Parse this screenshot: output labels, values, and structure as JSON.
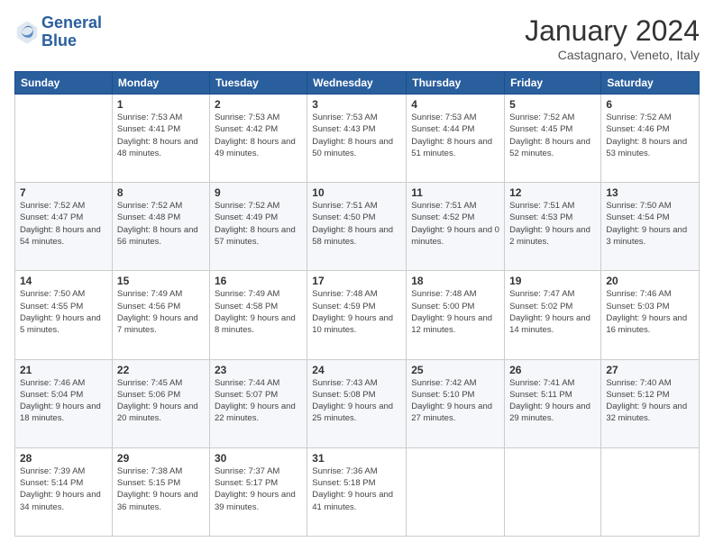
{
  "header": {
    "logo_line1": "General",
    "logo_line2": "Blue",
    "month_title": "January 2024",
    "subtitle": "Castagnaro, Veneto, Italy"
  },
  "days_of_week": [
    "Sunday",
    "Monday",
    "Tuesday",
    "Wednesday",
    "Thursday",
    "Friday",
    "Saturday"
  ],
  "weeks": [
    [
      {
        "day": "",
        "sunrise": "",
        "sunset": "",
        "daylight": ""
      },
      {
        "day": "1",
        "sunrise": "Sunrise: 7:53 AM",
        "sunset": "Sunset: 4:41 PM",
        "daylight": "Daylight: 8 hours and 48 minutes."
      },
      {
        "day": "2",
        "sunrise": "Sunrise: 7:53 AM",
        "sunset": "Sunset: 4:42 PM",
        "daylight": "Daylight: 8 hours and 49 minutes."
      },
      {
        "day": "3",
        "sunrise": "Sunrise: 7:53 AM",
        "sunset": "Sunset: 4:43 PM",
        "daylight": "Daylight: 8 hours and 50 minutes."
      },
      {
        "day": "4",
        "sunrise": "Sunrise: 7:53 AM",
        "sunset": "Sunset: 4:44 PM",
        "daylight": "Daylight: 8 hours and 51 minutes."
      },
      {
        "day": "5",
        "sunrise": "Sunrise: 7:52 AM",
        "sunset": "Sunset: 4:45 PM",
        "daylight": "Daylight: 8 hours and 52 minutes."
      },
      {
        "day": "6",
        "sunrise": "Sunrise: 7:52 AM",
        "sunset": "Sunset: 4:46 PM",
        "daylight": "Daylight: 8 hours and 53 minutes."
      }
    ],
    [
      {
        "day": "7",
        "sunrise": "Sunrise: 7:52 AM",
        "sunset": "Sunset: 4:47 PM",
        "daylight": "Daylight: 8 hours and 54 minutes."
      },
      {
        "day": "8",
        "sunrise": "Sunrise: 7:52 AM",
        "sunset": "Sunset: 4:48 PM",
        "daylight": "Daylight: 8 hours and 56 minutes."
      },
      {
        "day": "9",
        "sunrise": "Sunrise: 7:52 AM",
        "sunset": "Sunset: 4:49 PM",
        "daylight": "Daylight: 8 hours and 57 minutes."
      },
      {
        "day": "10",
        "sunrise": "Sunrise: 7:51 AM",
        "sunset": "Sunset: 4:50 PM",
        "daylight": "Daylight: 8 hours and 58 minutes."
      },
      {
        "day": "11",
        "sunrise": "Sunrise: 7:51 AM",
        "sunset": "Sunset: 4:52 PM",
        "daylight": "Daylight: 9 hours and 0 minutes."
      },
      {
        "day": "12",
        "sunrise": "Sunrise: 7:51 AM",
        "sunset": "Sunset: 4:53 PM",
        "daylight": "Daylight: 9 hours and 2 minutes."
      },
      {
        "day": "13",
        "sunrise": "Sunrise: 7:50 AM",
        "sunset": "Sunset: 4:54 PM",
        "daylight": "Daylight: 9 hours and 3 minutes."
      }
    ],
    [
      {
        "day": "14",
        "sunrise": "Sunrise: 7:50 AM",
        "sunset": "Sunset: 4:55 PM",
        "daylight": "Daylight: 9 hours and 5 minutes."
      },
      {
        "day": "15",
        "sunrise": "Sunrise: 7:49 AM",
        "sunset": "Sunset: 4:56 PM",
        "daylight": "Daylight: 9 hours and 7 minutes."
      },
      {
        "day": "16",
        "sunrise": "Sunrise: 7:49 AM",
        "sunset": "Sunset: 4:58 PM",
        "daylight": "Daylight: 9 hours and 8 minutes."
      },
      {
        "day": "17",
        "sunrise": "Sunrise: 7:48 AM",
        "sunset": "Sunset: 4:59 PM",
        "daylight": "Daylight: 9 hours and 10 minutes."
      },
      {
        "day": "18",
        "sunrise": "Sunrise: 7:48 AM",
        "sunset": "Sunset: 5:00 PM",
        "daylight": "Daylight: 9 hours and 12 minutes."
      },
      {
        "day": "19",
        "sunrise": "Sunrise: 7:47 AM",
        "sunset": "Sunset: 5:02 PM",
        "daylight": "Daylight: 9 hours and 14 minutes."
      },
      {
        "day": "20",
        "sunrise": "Sunrise: 7:46 AM",
        "sunset": "Sunset: 5:03 PM",
        "daylight": "Daylight: 9 hours and 16 minutes."
      }
    ],
    [
      {
        "day": "21",
        "sunrise": "Sunrise: 7:46 AM",
        "sunset": "Sunset: 5:04 PM",
        "daylight": "Daylight: 9 hours and 18 minutes."
      },
      {
        "day": "22",
        "sunrise": "Sunrise: 7:45 AM",
        "sunset": "Sunset: 5:06 PM",
        "daylight": "Daylight: 9 hours and 20 minutes."
      },
      {
        "day": "23",
        "sunrise": "Sunrise: 7:44 AM",
        "sunset": "Sunset: 5:07 PM",
        "daylight": "Daylight: 9 hours and 22 minutes."
      },
      {
        "day": "24",
        "sunrise": "Sunrise: 7:43 AM",
        "sunset": "Sunset: 5:08 PM",
        "daylight": "Daylight: 9 hours and 25 minutes."
      },
      {
        "day": "25",
        "sunrise": "Sunrise: 7:42 AM",
        "sunset": "Sunset: 5:10 PM",
        "daylight": "Daylight: 9 hours and 27 minutes."
      },
      {
        "day": "26",
        "sunrise": "Sunrise: 7:41 AM",
        "sunset": "Sunset: 5:11 PM",
        "daylight": "Daylight: 9 hours and 29 minutes."
      },
      {
        "day": "27",
        "sunrise": "Sunrise: 7:40 AM",
        "sunset": "Sunset: 5:12 PM",
        "daylight": "Daylight: 9 hours and 32 minutes."
      }
    ],
    [
      {
        "day": "28",
        "sunrise": "Sunrise: 7:39 AM",
        "sunset": "Sunset: 5:14 PM",
        "daylight": "Daylight: 9 hours and 34 minutes."
      },
      {
        "day": "29",
        "sunrise": "Sunrise: 7:38 AM",
        "sunset": "Sunset: 5:15 PM",
        "daylight": "Daylight: 9 hours and 36 minutes."
      },
      {
        "day": "30",
        "sunrise": "Sunrise: 7:37 AM",
        "sunset": "Sunset: 5:17 PM",
        "daylight": "Daylight: 9 hours and 39 minutes."
      },
      {
        "day": "31",
        "sunrise": "Sunrise: 7:36 AM",
        "sunset": "Sunset: 5:18 PM",
        "daylight": "Daylight: 9 hours and 41 minutes."
      },
      {
        "day": "",
        "sunrise": "",
        "sunset": "",
        "daylight": ""
      },
      {
        "day": "",
        "sunrise": "",
        "sunset": "",
        "daylight": ""
      },
      {
        "day": "",
        "sunrise": "",
        "sunset": "",
        "daylight": ""
      }
    ]
  ]
}
